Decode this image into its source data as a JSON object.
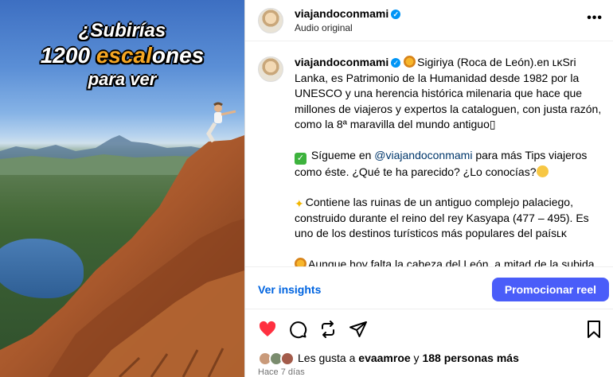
{
  "media": {
    "headline_line1": "¿Subirías",
    "headline_line2_a": "1200 ",
    "headline_line2_b": "escal",
    "headline_line2_c": "ones",
    "headline_line3": "para ver"
  },
  "header": {
    "username": "viajandoconmami",
    "verified_mark": "✓",
    "subtitle": "Audio original",
    "more_icon": "•••"
  },
  "caption": {
    "username": "viajandoconmami",
    "verified_mark": "✓",
    "p1": "Sigiriya (Roca de León).en ʟκSri Lanka, es Patrimonio de la Humanidad desde 1982 por la UNESCO y una herencia histórica milenaria que hace que millones de viajeros y expertos la cataloguen, con justa razón, como la 8ª maravilla del mundo antiguo▯",
    "p2_a": "Sígueme en ",
    "p2_mention": "@viajandoconmami",
    "p2_b": " para más Tips viajeros como éste. ¿Qué te ha parecido? ¿Lo conocías?",
    "p3": "Contiene las ruinas de un antiguo complejo palaciego, construido durante el reino del rey Kasyapa (477 – 495). Es uno de los destinos turísticos más populares del paísʟκ",
    "p4": "Aunque hoy falta la cabeza del León, a mitad de la subida, en una terraza, quedan dos enormes garras de piedra."
  },
  "insights": {
    "link_label": "Ver insights",
    "promote_label": "Promocionar reel"
  },
  "likes": {
    "prefix": "Les gusta a ",
    "user": "evaamroe",
    "middle": " y ",
    "others": "188 personas más"
  },
  "time": "Hace 7 días",
  "colors": {
    "accent": "#0064e0",
    "promote": "#4a5df9",
    "like_red": "#ff3040",
    "headline_orange": "#f5a623"
  }
}
